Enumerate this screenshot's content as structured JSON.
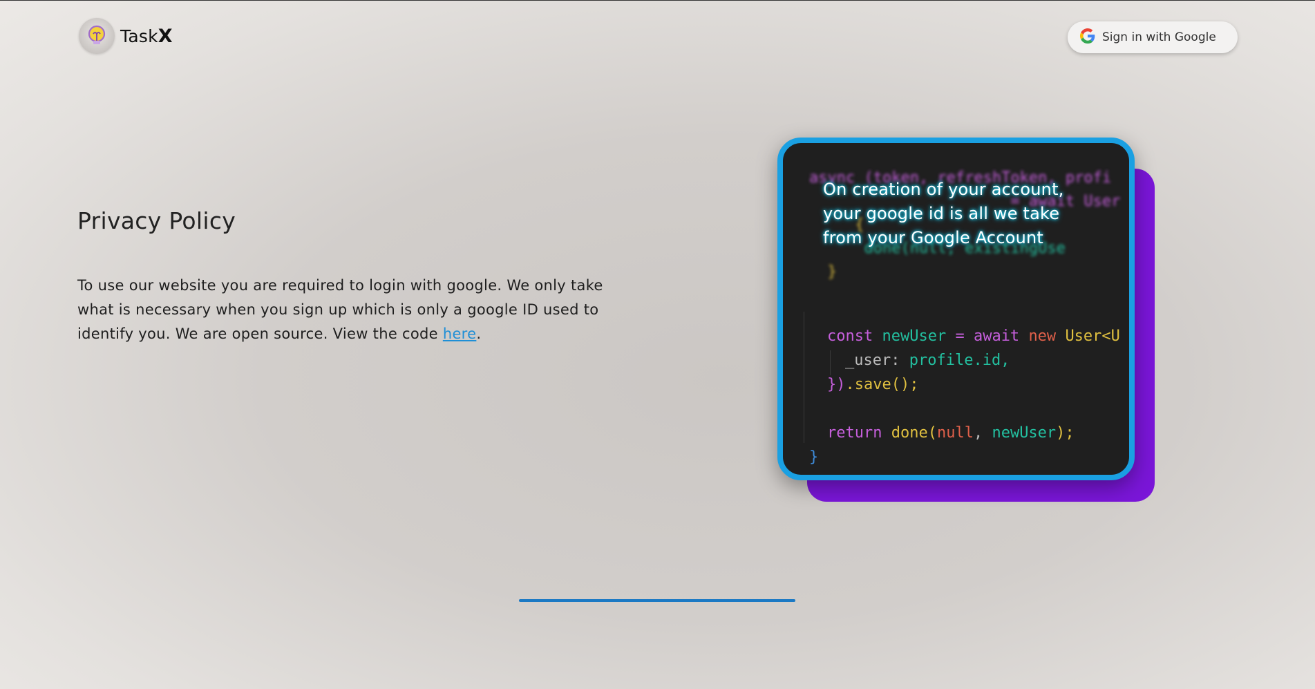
{
  "header": {
    "brand_name": "Task",
    "brand_suffix": "X",
    "signin_label": "Sign in with Google"
  },
  "main": {
    "title": "Privacy Policy",
    "paragraph_text": "To use our website you are required to login with google. We only take what is necessary when you sign up which is only a google ID used to identify you. We are open source. View the code ",
    "link_label": "here",
    "paragraph_end": "."
  },
  "card": {
    "caption": "On creation of your account, your google id is all we take from your Google Account",
    "blurred_code": {
      "line1": "async (token, refreshToken, profi",
      "line2": "= await User",
      "line3": "done(null, existingUse"
    },
    "code": {
      "l1_kw1": "const",
      "l1_var": "newUser",
      "l1_eq": "=",
      "l1_kw2": "await",
      "l1_kw3": "new",
      "l1_cls": "User<U",
      "l2_key": "_user:",
      "l2_val": "profile.id,",
      "l3_a": "})",
      "l3_b": ".save();",
      "l4_kw": "return",
      "l4_fn": "done(",
      "l4_null": "null",
      "l4_comma": ",",
      "l4_var": "newUser",
      "l4_end": ");",
      "l5": "}"
    }
  },
  "colors": {
    "accent_blue": "#1aa0e2",
    "accent_purple": "#7a16d8",
    "link": "#1f8fd6"
  },
  "icons": {
    "logo": "lightbulb-icon",
    "signin": "google-g-icon"
  }
}
